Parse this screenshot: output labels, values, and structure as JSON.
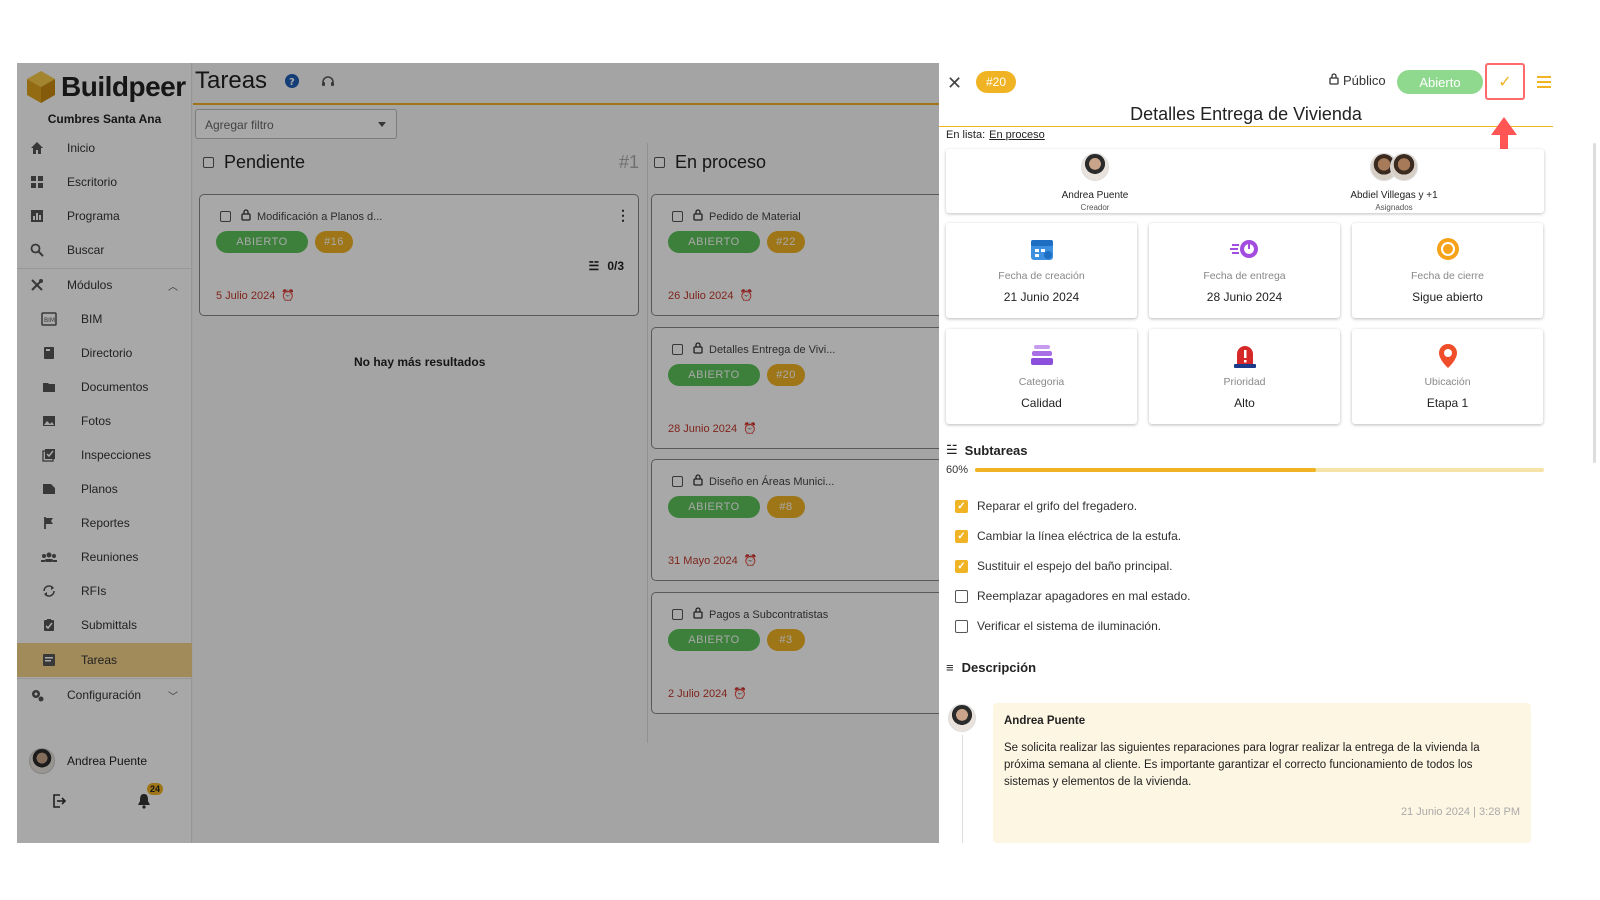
{
  "app": {
    "brand": "Buildpeer",
    "project": "Cumbres Santa Ana"
  },
  "sidebar": {
    "items": [
      {
        "label": "Inicio",
        "icon": "home-icon"
      },
      {
        "label": "Escritorio",
        "icon": "dashboard-icon"
      },
      {
        "label": "Programa",
        "icon": "chart-icon"
      },
      {
        "label": "Buscar",
        "icon": "search-icon"
      },
      {
        "label": "Módulos",
        "icon": "tools-icon"
      }
    ],
    "modules": [
      {
        "label": "BIM",
        "icon": "bim-icon"
      },
      {
        "label": "Directorio",
        "icon": "book-icon"
      },
      {
        "label": "Documentos",
        "icon": "folder-icon"
      },
      {
        "label": "Fotos",
        "icon": "image-icon"
      },
      {
        "label": "Inspecciones",
        "icon": "checklist-icon"
      },
      {
        "label": "Planos",
        "icon": "file-icon"
      },
      {
        "label": "Reportes",
        "icon": "flag-icon"
      },
      {
        "label": "Reuniones",
        "icon": "people-icon"
      },
      {
        "label": "RFIs",
        "icon": "sync-icon"
      },
      {
        "label": "Submittals",
        "icon": "clipboard-check-icon"
      },
      {
        "label": "Tareas",
        "icon": "task-icon"
      }
    ],
    "config_label": "Configuración",
    "user_name": "Andrea Puente",
    "notifications_count": "24"
  },
  "main": {
    "title": "Tareas",
    "filter_placeholder": "Agregar filtro",
    "columns": [
      {
        "title": "Pendiente",
        "count": "#1"
      },
      {
        "title": "En proceso"
      }
    ],
    "pending_cards": [
      {
        "title": "Modificación a Planos d...",
        "status": "ABIERTO",
        "id": "#16",
        "date": "5 Julio 2024",
        "subtasks": "0/3"
      }
    ],
    "no_more": "No hay más resultados",
    "progress_cards": [
      {
        "title": "Pedido de Material",
        "status": "ABIERTO",
        "id": "#22",
        "date": "26 Julio 2024"
      },
      {
        "title": "Detalles Entrega de Vivi...",
        "status": "ABIERTO",
        "id": "#20",
        "date": "28 Junio 2024"
      },
      {
        "title": "Diseño en Áreas Munici...",
        "status": "ABIERTO",
        "id": "#8",
        "date": "31 Mayo 2024"
      },
      {
        "title": "Pagos a Subcontratistas",
        "status": "ABIERTO",
        "id": "#3",
        "date": "2 Julio 2024"
      }
    ]
  },
  "panel": {
    "id": "#20",
    "visibility": "Público",
    "status": "Abierto",
    "title": "Detalles Entrega de Vivienda",
    "list_label": "En lista:",
    "list_value": "En proceso",
    "creator": {
      "name": "Andrea Puente",
      "role": "Creador"
    },
    "assignees": {
      "name": "Abdiel Villegas y +1",
      "role": "Asignados"
    },
    "info": [
      {
        "label": "Fecha de creación",
        "value": "21 Junio 2024",
        "icon": "calendar-icon"
      },
      {
        "label": "Fecha de entrega",
        "value": "28 Junio 2024",
        "icon": "timer-icon"
      },
      {
        "label": "Fecha de cierre",
        "value": "Sigue abierto",
        "icon": "sun-icon"
      },
      {
        "label": "Categoria",
        "value": "Calidad",
        "icon": "layers-icon"
      },
      {
        "label": "Prioridad",
        "value": "Alto",
        "icon": "alarm-icon"
      },
      {
        "label": "Ubicación",
        "value": "Etapa 1",
        "icon": "location-pin-icon"
      }
    ],
    "subtasks_title": "Subtareas",
    "progress_label": "60%",
    "progress": 0.6,
    "subtasks": [
      {
        "text": "Reparar el grifo del fregadero.",
        "done": true
      },
      {
        "text": "Cambiar la línea eléctrica de la estufa.",
        "done": true
      },
      {
        "text": "Sustituir el espejo del baño principal.",
        "done": true
      },
      {
        "text": "Reemplazar apagadores en mal estado.",
        "done": false
      },
      {
        "text": "Verificar el sistema de iluminación.",
        "done": false
      }
    ],
    "description_title": "Descripción",
    "comment": {
      "author": "Andrea Puente",
      "body": "Se solicita realizar las siguientes reparaciones para lograr realizar la entrega de la vivienda la próxima semana al cliente. Es importante garantizar el correcto funcionamiento de todos los sistemas y elementos de la vivienda.",
      "date": "21 Junio 2024 | 3:28 PM"
    }
  },
  "colors": {
    "accent": "#f0b323",
    "open_green": "#5cc25c",
    "highlight_red": "#ff6b6b"
  }
}
